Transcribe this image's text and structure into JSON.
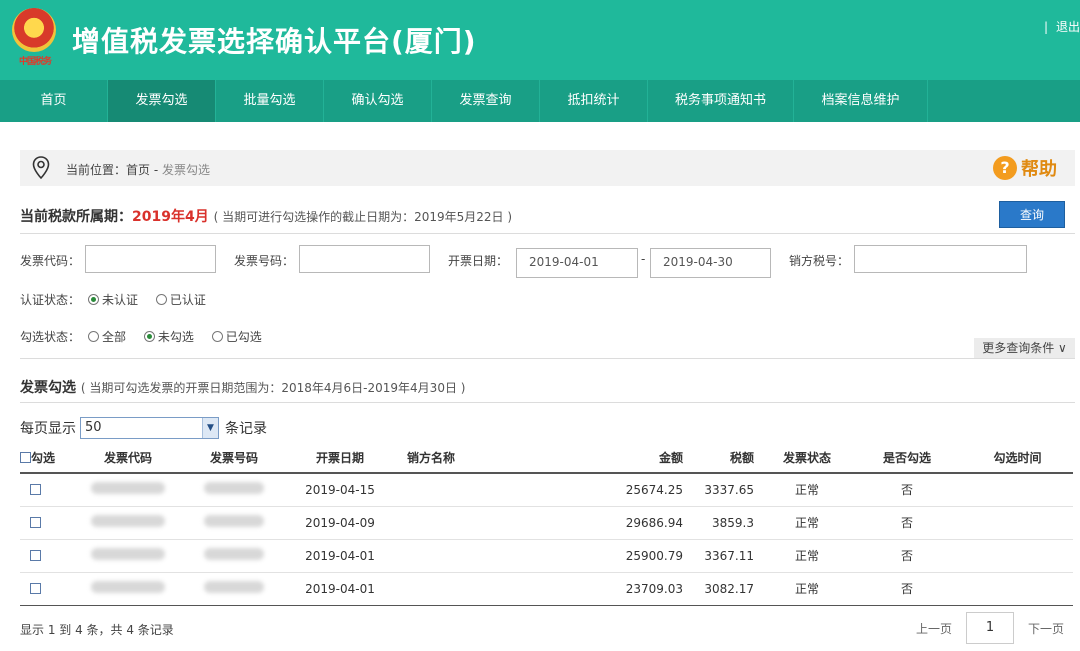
{
  "app": {
    "title": "增值税发票选择确认平台(厦门)",
    "logout": "退出",
    "emblem_text": "中国税务"
  },
  "nav": [
    {
      "label": "首页"
    },
    {
      "label": "发票勾选"
    },
    {
      "label": "批量勾选"
    },
    {
      "label": "确认勾选"
    },
    {
      "label": "发票查询"
    },
    {
      "label": "抵扣统计"
    },
    {
      "label": "税务事项通知书"
    },
    {
      "label": "档案信息维护"
    }
  ],
  "breadcrumb": {
    "prefix": "当前位置：首页 - ",
    "current": "发票勾选"
  },
  "help": {
    "label": "帮助",
    "icon": "?"
  },
  "period": {
    "label": "当前税款所属期：",
    "value": "2019年4月",
    "note": "( 当期可进行勾选操作的截止日期为：2019年5月22日 )"
  },
  "query_button": "查询",
  "filters": {
    "invoice_code_label": "发票代码：",
    "invoice_code_value": "",
    "invoice_number_label": "发票号码：",
    "invoice_number_value": "",
    "issue_date_label": "开票日期：",
    "date_from": "2019-04-01",
    "date_sep": "-",
    "date_to": "2019-04-30",
    "seller_tax_label": "销方税号：",
    "seller_tax_value": "",
    "cert_status_label": "认证状态：",
    "cert_options": [
      "未认证",
      "已认证"
    ],
    "select_status_label": "勾选状态：",
    "select_options": [
      "全部",
      "未勾选",
      "已勾选"
    ],
    "more_conditions": "更多查询条件 ∨"
  },
  "section": {
    "title": "发票勾选",
    "note": "( 当期可勾选发票的开票日期范围为：2018年4月6日-2019年4月30日 )"
  },
  "perpage": {
    "label": "每页显示",
    "value": "50",
    "suffix": "条记录"
  },
  "table": {
    "headers": [
      "勾选",
      "发票代码",
      "发票号码",
      "开票日期",
      "销方名称",
      "金额",
      "税额",
      "发票状态",
      "是否勾选",
      "勾选时间"
    ],
    "rows": [
      {
        "date": "2019-04-15",
        "amount": "25674.25",
        "tax": "3337.65",
        "status": "正常",
        "selected": "否"
      },
      {
        "date": "2019-04-09",
        "amount": "29686.94",
        "tax": "3859.3",
        "status": "正常",
        "selected": "否"
      },
      {
        "date": "2019-04-01",
        "amount": "25900.79",
        "tax": "3367.11",
        "status": "正常",
        "selected": "否"
      },
      {
        "date": "2019-04-01",
        "amount": "23709.03",
        "tax": "3082.17",
        "status": "正常",
        "selected": "否"
      }
    ]
  },
  "footer": {
    "info": "显示 1 到 4 条，共 4 条记录",
    "prev": "上一页",
    "page": "1",
    "next": "下一页"
  },
  "colors": {
    "header": "#1fb99b",
    "nav": "#199f86",
    "accent_red": "#d9312b",
    "button_blue": "#2a79c9",
    "help_orange": "#f39c1f"
  }
}
